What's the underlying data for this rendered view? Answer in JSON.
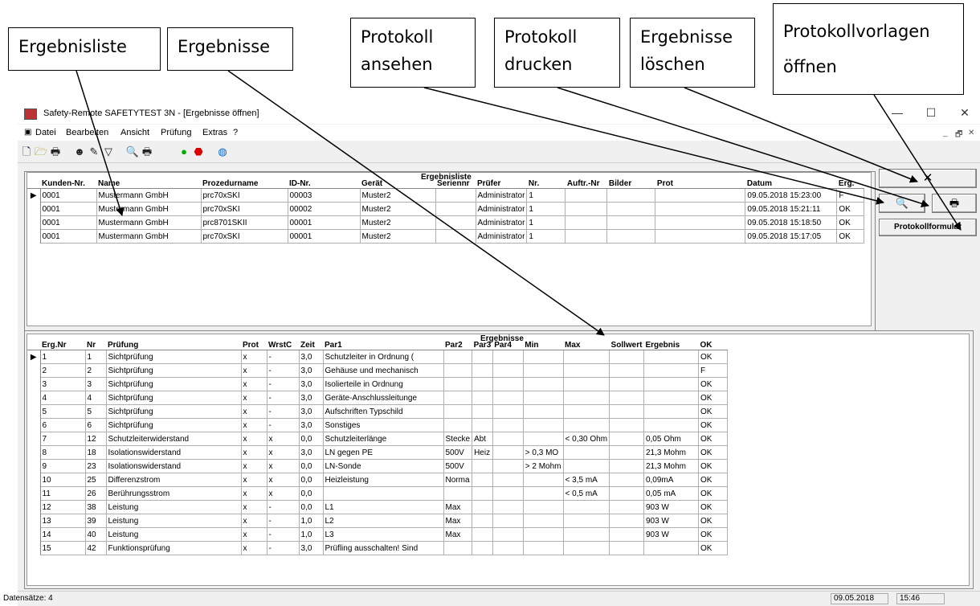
{
  "callouts": {
    "ergebnisliste": "Ergebnisliste",
    "ergebnisse": "Ergebnisse",
    "protokoll_ansehen_1": "Protokoll",
    "protokoll_ansehen_2": "ansehen",
    "protokoll_drucken_1": "Protokoll",
    "protokoll_drucken_2": "drucken",
    "ergebnisse_loeschen_1": "Ergebnisse",
    "ergebnisse_loeschen_2": "löschen",
    "vorlagen_1": "Protokollvorlagen",
    "vorlagen_2": "öffnen"
  },
  "window": {
    "title": "Safety-Remote SAFETYTEST 3N - [Ergebnisse öffnen]",
    "minimize": "—",
    "maximize": "☐",
    "close": "✕"
  },
  "menu": {
    "items": [
      "Datei",
      "Bearbeiten",
      "Ansicht",
      "Prüfung",
      "Extras",
      "?"
    ],
    "mdi_min": "_",
    "mdi_restore": "🗗",
    "mdi_close": "✕"
  },
  "toolbar_icons": [
    "new-icon",
    "open-icon",
    "print-icon",
    "user-icon",
    "edit-icon",
    "filter-icon",
    "preview-icon",
    "printer-icon",
    "exit-icon",
    "stop-icon",
    "globe-icon"
  ],
  "ergebnisliste": {
    "title": "Ergebnisliste",
    "columns": [
      "Kunden-Nr.",
      "Name",
      "Prozedurname",
      "ID-Nr.",
      "Gerät",
      "Seriennr",
      "Prüfer",
      "Nr.",
      "Auftr.-Nr",
      "Bilder",
      "Prot",
      "Datum",
      "Erg."
    ],
    "rows": [
      [
        "0001",
        "Mustermann GmbH",
        "prc70xSKI",
        "00003",
        "Muster2",
        "",
        "Administrator",
        "1",
        "",
        "",
        "",
        "09.05.2018 15:23:00",
        "F"
      ],
      [
        "0001",
        "Mustermann GmbH",
        "prc70xSKI",
        "00002",
        "Muster2",
        "",
        "Administrator",
        "1",
        "",
        "",
        "",
        "09.05.2018 15:21:11",
        "OK"
      ],
      [
        "0001",
        "Mustermann GmbH",
        "prc8701SKII",
        "00001",
        "Muster2",
        "",
        "Administrator",
        "1",
        "",
        "",
        "",
        "09.05.2018 15:18:50",
        "OK"
      ],
      [
        "0001",
        "Mustermann GmbH",
        "prc70xSKI",
        "00001",
        "Muster2",
        "",
        "Administrator",
        "1",
        "",
        "",
        "",
        "09.05.2018 15:17:05",
        "OK"
      ]
    ]
  },
  "ergebnisse": {
    "title": "Ergebnisse",
    "columns": [
      "Erg.Nr",
      "Nr",
      "Prüfung",
      "Prot",
      "WrstC",
      "Zeit",
      "Par1",
      "Par2",
      "Par3",
      "Par4",
      "Min",
      "Max",
      "Sollwert",
      "Ergebnis",
      "OK"
    ],
    "rows": [
      [
        "1",
        "1",
        "Sichtprüfung",
        "x",
        "-",
        "3,0",
        "Schutzleiter in Ordnung (",
        "",
        "",
        "",
        "",
        "",
        "",
        "",
        "OK"
      ],
      [
        "2",
        "2",
        "Sichtprüfung",
        "x",
        "-",
        "3,0",
        "Gehäuse und mechanisch",
        "",
        "",
        "",
        "",
        "",
        "",
        "",
        "F"
      ],
      [
        "3",
        "3",
        "Sichtprüfung",
        "x",
        "-",
        "3,0",
        "Isolierteile in Ordnung",
        "",
        "",
        "",
        "",
        "",
        "",
        "",
        "OK"
      ],
      [
        "4",
        "4",
        "Sichtprüfung",
        "x",
        "-",
        "3,0",
        "Geräte-Anschlussleitunge",
        "",
        "",
        "",
        "",
        "",
        "",
        "",
        "OK"
      ],
      [
        "5",
        "5",
        "Sichtprüfung",
        "x",
        "-",
        "3,0",
        "Aufschriften Typschild",
        "",
        "",
        "",
        "",
        "",
        "",
        "",
        "OK"
      ],
      [
        "6",
        "6",
        "Sichtprüfung",
        "x",
        "-",
        "3,0",
        "Sonstiges",
        "",
        "",
        "",
        "",
        "",
        "",
        "",
        "OK"
      ],
      [
        "7",
        "12",
        "Schutzleiterwiderstand",
        "x",
        "x",
        "0,0",
        "Schutzleiterlänge",
        "Stecke",
        "Abt",
        "",
        "",
        "< 0,30 Ohm",
        "",
        "0,05 Ohm",
        "OK"
      ],
      [
        "8",
        "18",
        "Isolationswiderstand",
        "x",
        "x",
        "3,0",
        "LN gegen PE",
        "500V",
        "Heiz",
        "",
        "> 0,3 MO",
        "",
        "",
        "21,3 Mohm",
        "OK"
      ],
      [
        "9",
        "23",
        "Isolationswiderstand",
        "x",
        "x",
        "0,0",
        "LN-Sonde",
        "500V",
        "",
        "",
        "> 2 Mohm",
        "",
        "",
        "21,3 Mohm",
        "OK"
      ],
      [
        "10",
        "25",
        "Differenzstrom",
        "x",
        "x",
        "0,0",
        "Heizleistung",
        "Norma",
        "",
        "",
        "",
        "< 3,5 mA",
        "",
        "0,09mA",
        "OK"
      ],
      [
        "11",
        "26",
        "Berührungsstrom",
        "x",
        "x",
        "0,0",
        "",
        "",
        "",
        "",
        "",
        "< 0,5 mA",
        "",
        "0,05 mA",
        "OK"
      ],
      [
        "12",
        "38",
        "Leistung",
        "x",
        "-",
        "0,0",
        "L1",
        "Max",
        "",
        "",
        "",
        "",
        "",
        "903 W",
        "OK"
      ],
      [
        "13",
        "39",
        "Leistung",
        "x",
        "-",
        "1,0",
        "L2",
        "Max",
        "",
        "",
        "",
        "",
        "",
        "903 W",
        "OK"
      ],
      [
        "14",
        "40",
        "Leistung",
        "x",
        "-",
        "1,0",
        "L3",
        "Max",
        "",
        "",
        "",
        "",
        "",
        "903 W",
        "OK"
      ],
      [
        "15",
        "42",
        "Funktionsprüfung",
        "x",
        "-",
        "3,0",
        "Prüfling ausschalten! Sind",
        "",
        "",
        "",
        "",
        "",
        "",
        "",
        "OK"
      ]
    ]
  },
  "buttons": {
    "delete": "✕",
    "preview": "🔍",
    "print": "🖶",
    "protokollformular": "Protokollformular"
  },
  "status": {
    "datensaetze": "Datensätze: 4",
    "date": "09.05.2018",
    "time": "15:46"
  }
}
